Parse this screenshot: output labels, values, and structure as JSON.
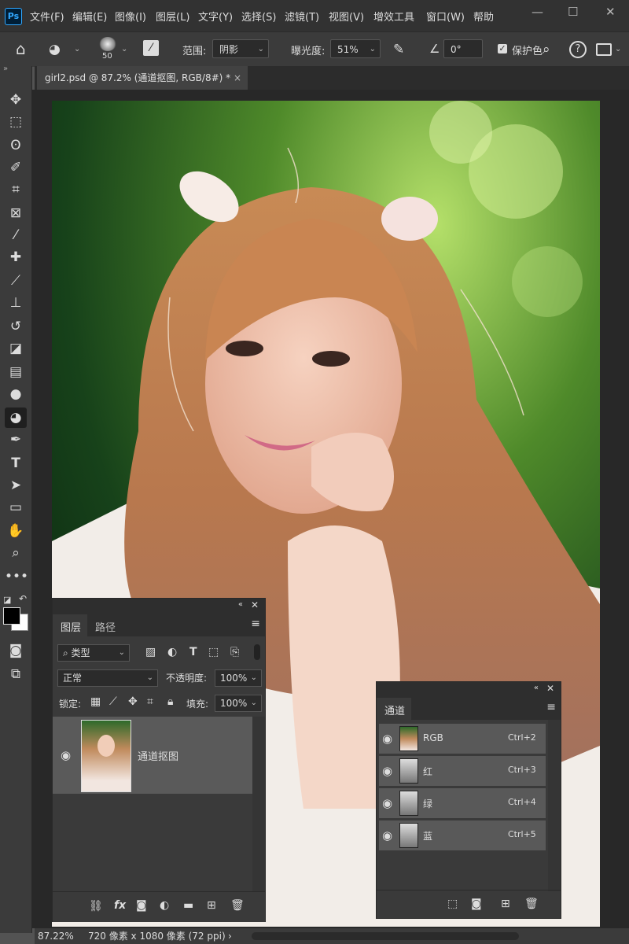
{
  "menubar": {
    "logo": "Ps",
    "items": [
      "文件(F)",
      "编辑(E)",
      "图像(I)",
      "图层(L)",
      "文字(Y)",
      "选择(S)",
      "滤镜(T)",
      "视图(V)",
      "增效工具",
      "窗口(W)",
      "帮助"
    ],
    "window_controls": [
      "—",
      "☐",
      "✕"
    ]
  },
  "options": {
    "brush_size": "50",
    "range_label": "范围:",
    "range_value": "阴影",
    "exposure_label": "曝光度:",
    "exposure_value": "51%",
    "angle_value": "0°",
    "protect_label": "保护色"
  },
  "document": {
    "tab_title": "girl2.psd @ 87.2% (通道抠图, RGB/8#) *",
    "close": "×"
  },
  "layers_panel": {
    "tabs": [
      "图层",
      "路径"
    ],
    "filter_kind": "类型",
    "blend_mode": "正常",
    "opacity_label": "不透明度:",
    "opacity_value": "100%",
    "lock_label": "锁定:",
    "fill_label": "填充:",
    "fill_value": "100%",
    "layers": [
      {
        "name": "通道抠图"
      }
    ],
    "bottom_icons": [
      "link-icon",
      "fx-icon",
      "mask-icon",
      "adjustment-icon",
      "folder-icon",
      "new-layer-icon",
      "trash-icon"
    ],
    "fx_label": "fx"
  },
  "channels_panel": {
    "tab": "通道",
    "channels": [
      {
        "name": "RGB",
        "shortcut": "Ctrl+2"
      },
      {
        "name": "红",
        "shortcut": "Ctrl+3"
      },
      {
        "name": "绿",
        "shortcut": "Ctrl+4"
      },
      {
        "name": "蓝",
        "shortcut": "Ctrl+5"
      }
    ]
  },
  "status": {
    "zoom": "87.22%",
    "info": "720 像素 x 1080 像素 (72 ppi)",
    "arrow": "›"
  },
  "colors": {
    "accent": "#31a8ff",
    "ui_dark": "#323232",
    "panel": "#3a3a3a"
  }
}
